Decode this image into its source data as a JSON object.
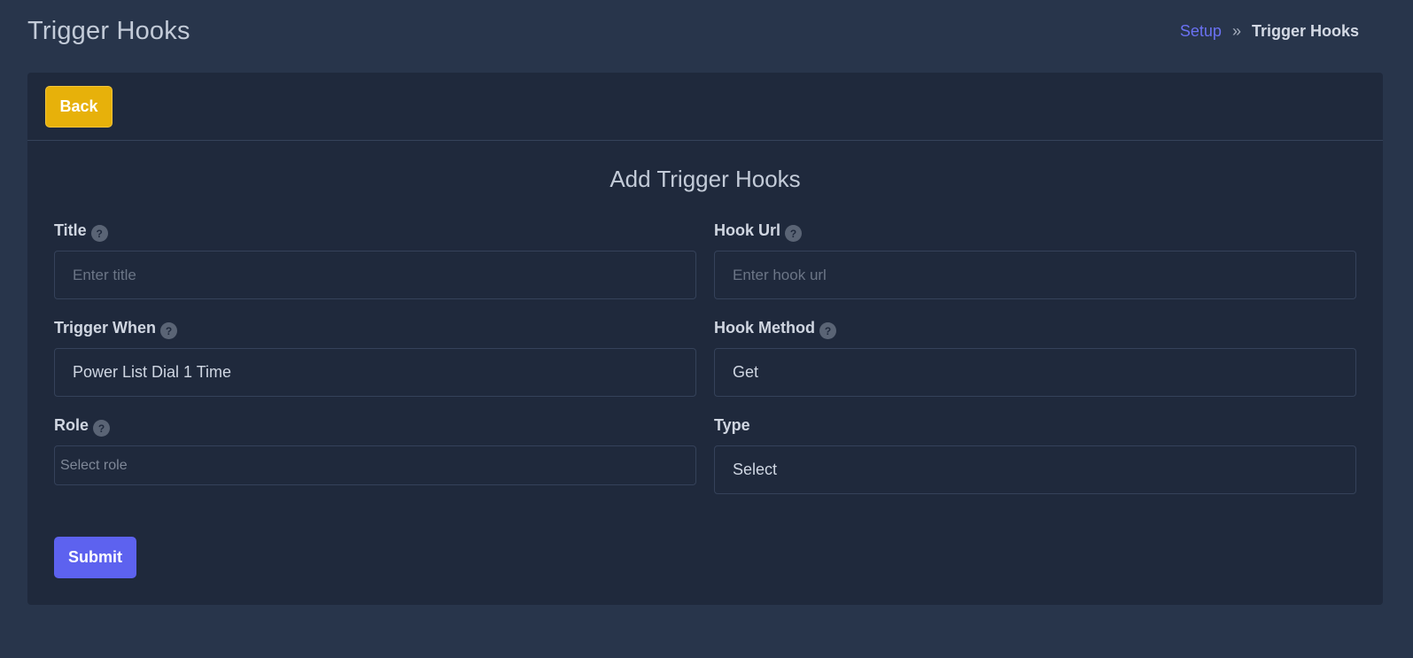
{
  "header": {
    "title": "Trigger Hooks",
    "breadcrumb": {
      "parent": "Setup",
      "separator": "»",
      "current": "Trigger Hooks"
    }
  },
  "toolbar": {
    "back_label": "Back"
  },
  "form": {
    "heading": "Add Trigger Hooks",
    "help_glyph": "?",
    "title_field": {
      "label": "Title",
      "placeholder": "Enter title",
      "value": ""
    },
    "hook_url_field": {
      "label": "Hook Url",
      "placeholder": "Enter hook url",
      "value": ""
    },
    "trigger_when_field": {
      "label": "Trigger When",
      "selected": "Power List Dial 1 Time"
    },
    "hook_method_field": {
      "label": "Hook Method",
      "selected": "Get"
    },
    "role_field": {
      "label": "Role",
      "placeholder": "Select role"
    },
    "type_field": {
      "label": "Type",
      "selected": "Select"
    },
    "submit_label": "Submit"
  },
  "colors": {
    "page_bg": "#28354b",
    "card_bg": "#1f293c",
    "accent": "#5d62ef",
    "back_button": "#e7b10a",
    "breadcrumb_link": "#6a71f2"
  },
  "icons": {
    "help": "question-circle-icon",
    "breadcrumb_separator": "double-chevron-right-icon"
  }
}
